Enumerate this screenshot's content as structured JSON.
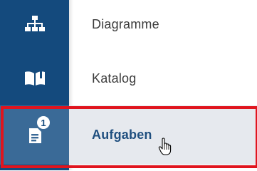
{
  "colors": {
    "rail": "#144a7d",
    "rail_active": "#3a6a97",
    "active_row_bg": "#e6e9ee",
    "highlight": "#e0141e",
    "active_label": "#1f4f7f"
  },
  "menu": {
    "items": [
      {
        "label": "Diagramme",
        "icon": "sitemap-icon"
      },
      {
        "label": "Katalog",
        "icon": "book-icon"
      },
      {
        "label": "Aufgaben",
        "icon": "task-list-icon",
        "badge": "1",
        "active": true
      }
    ]
  },
  "cursor": {
    "icon": "hand-pointer-icon"
  }
}
